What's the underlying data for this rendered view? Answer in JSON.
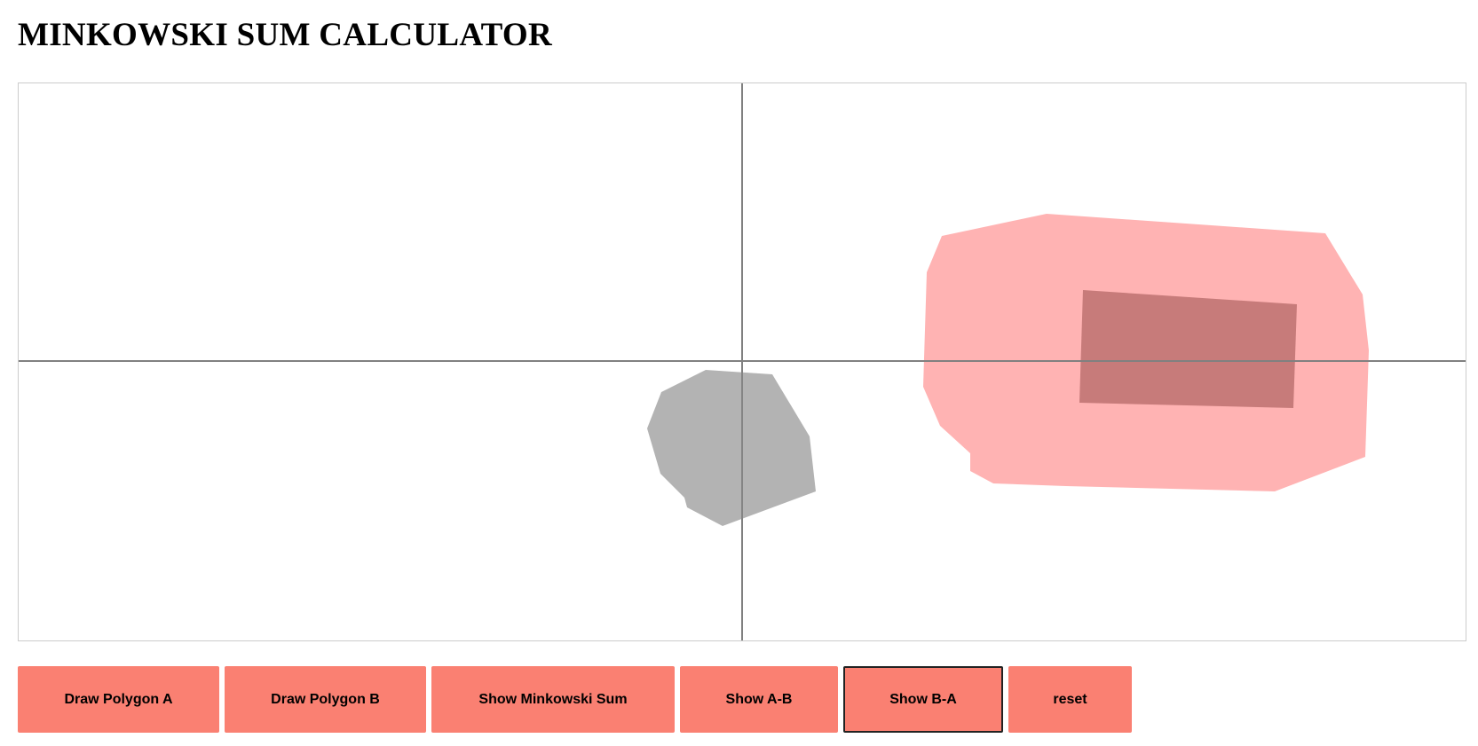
{
  "page": {
    "title": "MINKOWSKI SUM CALCULATOR"
  },
  "buttons": {
    "draw_a": "Draw Polygon A",
    "draw_b": "Draw Polygon B",
    "show_sum": "Show Minkowski Sum",
    "show_a_minus_b": "Show A-B",
    "show_b_minus_a": "Show B-A",
    "reset": "reset"
  },
  "colors": {
    "button_bg": "#fa8072",
    "axis": "#808080",
    "polygon_a": "#b3b3b3",
    "result_fill": "#ffb3b3",
    "polygon_b": "#c77b7a",
    "focused_border": "#222222"
  }
}
